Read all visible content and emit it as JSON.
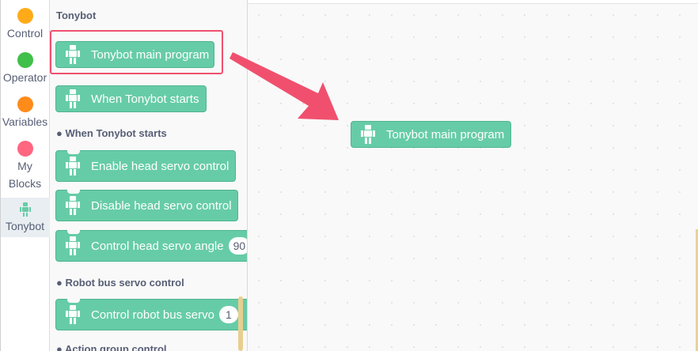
{
  "categories": [
    {
      "label": "Control",
      "color": "#ffab19",
      "icon": "circle"
    },
    {
      "label": "Operator",
      "color": "#40bf4a",
      "icon": "circle"
    },
    {
      "label": "Variables",
      "color": "#ff8c1a",
      "icon": "circle"
    },
    {
      "label_line1": "My",
      "label_line2": "Blocks",
      "color": "#ff6680",
      "icon": "circle"
    },
    {
      "label": "Tonybot",
      "icon": "robot-icon",
      "selected": true
    }
  ],
  "flyout": {
    "heading": "Tonybot",
    "blocks": [
      {
        "label": "Tonybot main program",
        "type": "hat"
      },
      {
        "label": "When Tonybot starts",
        "type": "hat"
      },
      {
        "label": "Enable head servo control",
        "type": "stack"
      },
      {
        "label": "Disable head servo control",
        "type": "stack"
      },
      {
        "label": "Control head servo angle",
        "type": "stack",
        "value": "90"
      },
      {
        "label": "Control robot bus servo",
        "type": "stack",
        "value": "1"
      }
    ],
    "sections": [
      {
        "label": "When Tonybot starts"
      },
      {
        "label": "Robot bus servo control"
      },
      {
        "label": "Action group control"
      }
    ]
  },
  "workspace": {
    "block_label": "Tonybot main program"
  },
  "colors": {
    "block_fill": "#66cca7",
    "highlight": "#f0506e",
    "arrow": "#f0506e"
  }
}
